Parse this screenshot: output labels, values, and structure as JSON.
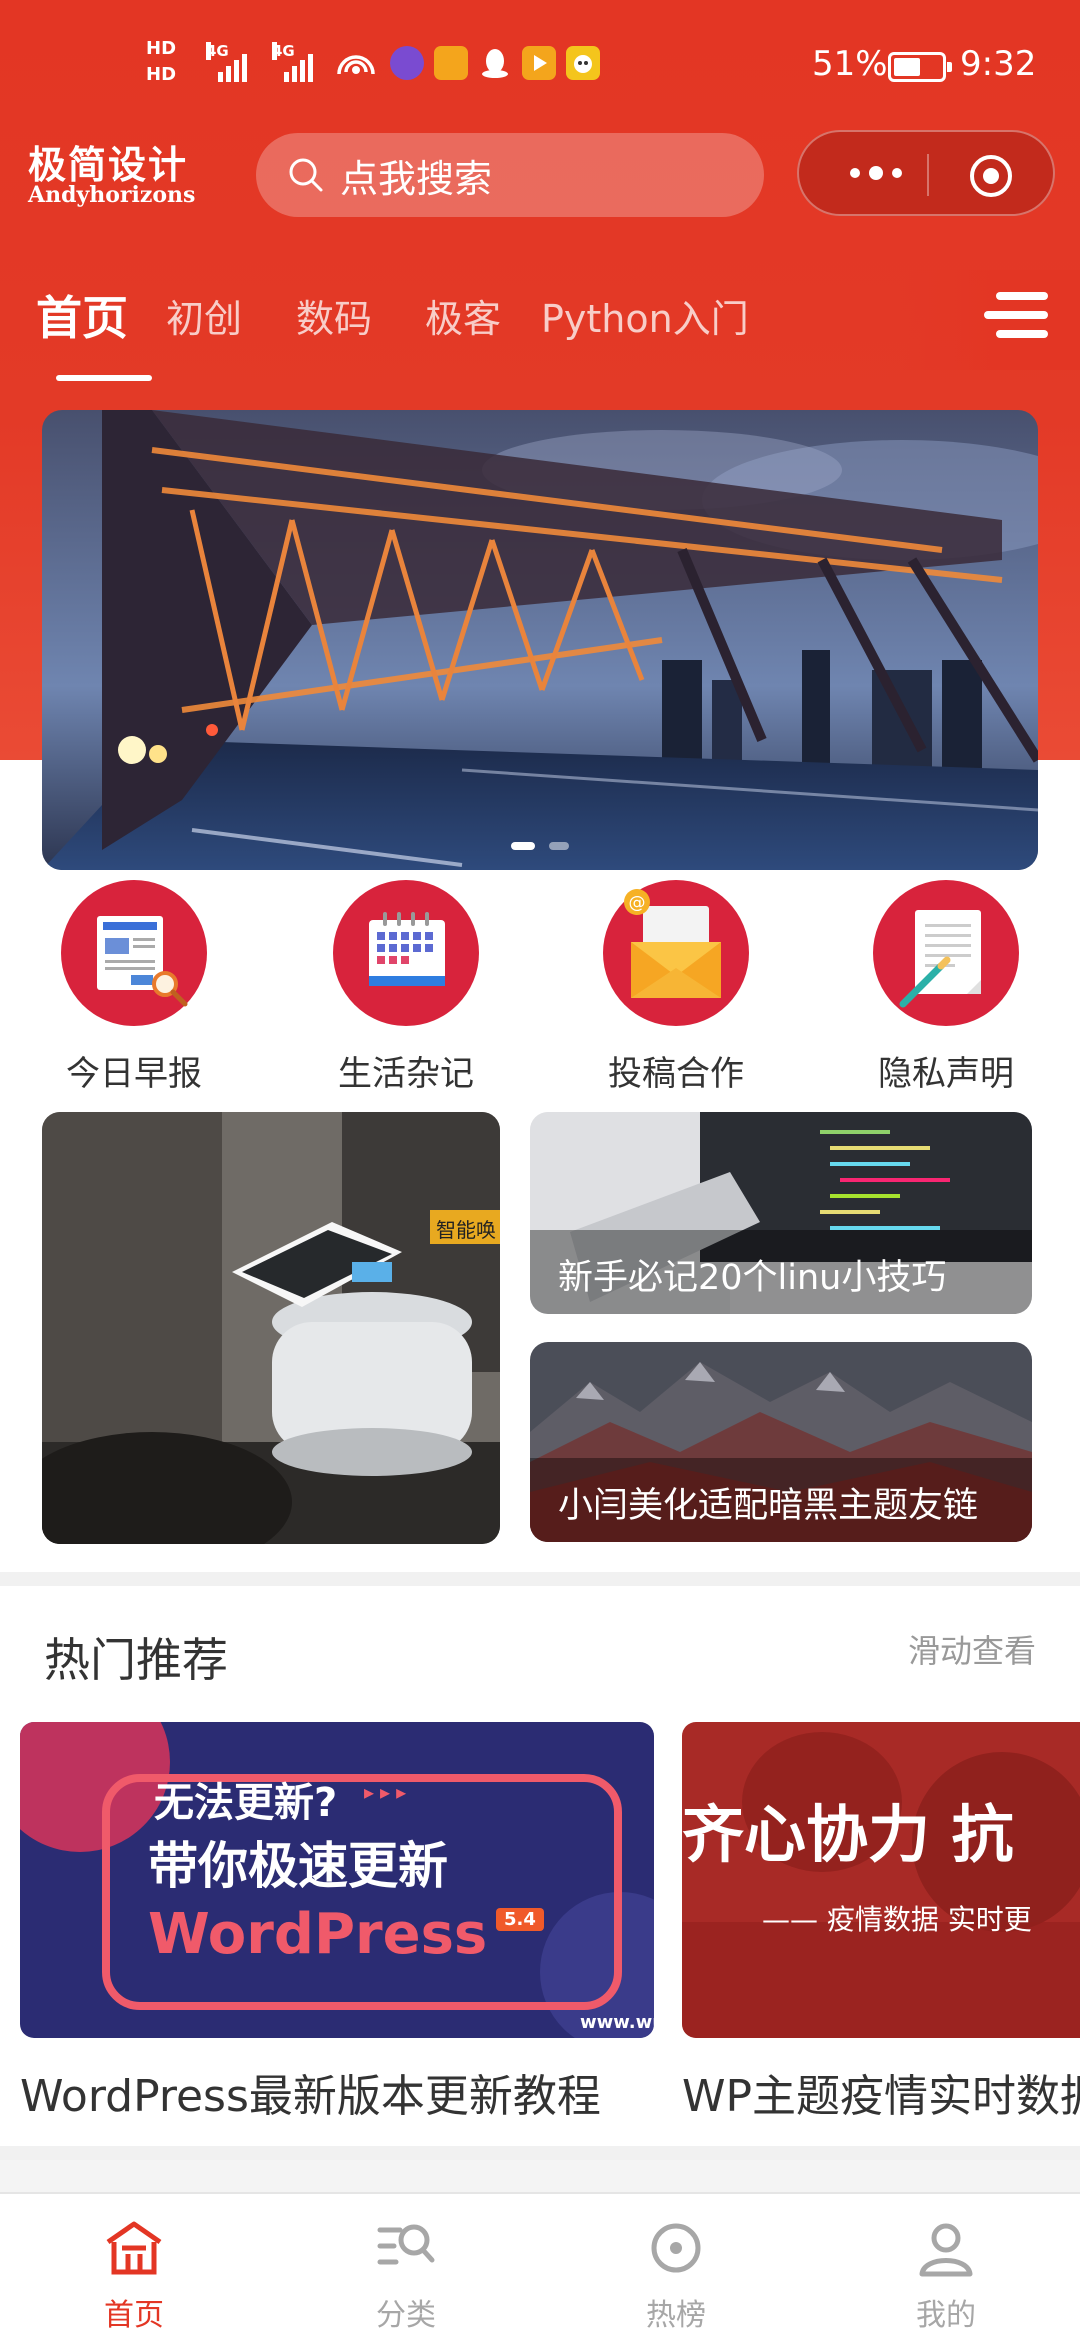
{
  "status_bar": {
    "hd1": "HD",
    "hd2": "HD",
    "network_1": "4G",
    "network_2": "4G",
    "battery_percent": "51%",
    "time": "9:32",
    "app_icon_colors": [
      "#7a4bd1",
      "#f4a51c",
      "#ffffff",
      "#f4a51c",
      "#f4c51c"
    ]
  },
  "header": {
    "logo_title": "极简设计",
    "logo_subtitle": "Andyhorizons",
    "search_placeholder": "点我搜索",
    "menu_icon": "more-dots-icon",
    "close_icon": "target-circle-icon"
  },
  "tabs": {
    "items": [
      "首页",
      "初创",
      "数码",
      "极客",
      "Python入门"
    ],
    "active_index": 0
  },
  "banner": {
    "slide_count": 2,
    "active_slide": 0
  },
  "quick_nav": [
    {
      "label": "今日早报",
      "icon": "newspaper-icon"
    },
    {
      "label": "生活杂记",
      "icon": "calendar-icon"
    },
    {
      "label": "投稿合作",
      "icon": "envelope-icon"
    },
    {
      "label": "隐私声明",
      "icon": "document-pen-icon"
    }
  ],
  "featured": {
    "main_tag": "智能唤",
    "side_cards": [
      {
        "caption": "新手必记20个linu小技巧"
      },
      {
        "caption": "小闫美化适配暗黑主题友链"
      }
    ]
  },
  "hot": {
    "title": "热门推荐",
    "more_label": "滑动查看",
    "cards": [
      {
        "caption": "WordPress最新版本更新教程",
        "line1": "无法更新?",
        "line2": "带你极速更新",
        "line3": "WordPress",
        "badge": "5.4",
        "url_text": "www.wp"
      },
      {
        "caption": "WP主题疫情实时数据",
        "big_text": "齐心协力 抗",
        "sub_text": "—— 疫情数据  实时更"
      }
    ]
  },
  "tabbar": {
    "items": [
      "首页",
      "分类",
      "热榜",
      "我的"
    ],
    "active_index": 0,
    "accent": "#e33624",
    "inactive": "#a7a7a7"
  }
}
